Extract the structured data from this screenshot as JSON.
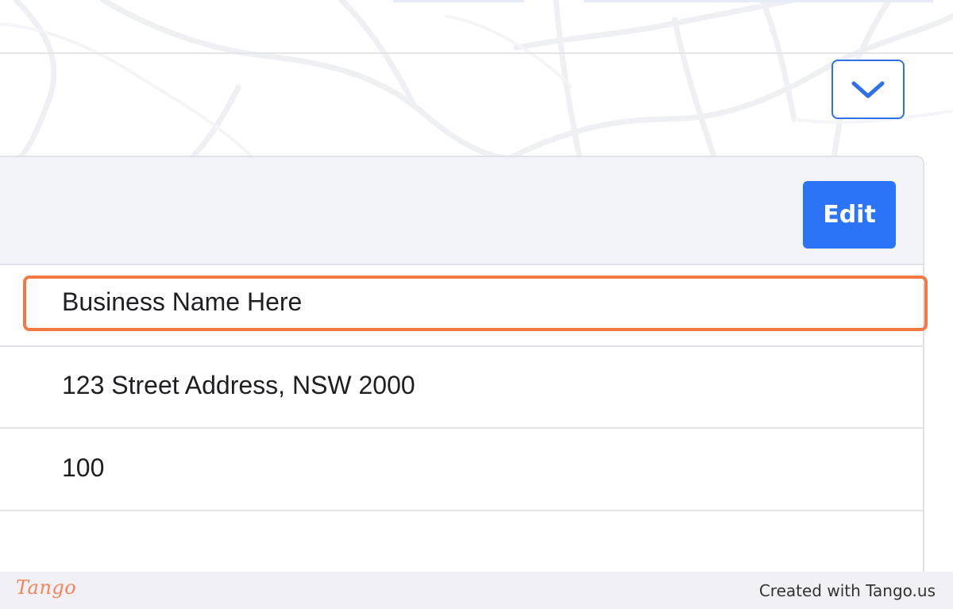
{
  "header": {
    "collapse_icon": "chevron-down-icon"
  },
  "card": {
    "edit_label": "Edit",
    "rows": [
      {
        "value": "Business Name Here"
      },
      {
        "value": "123 Street Address, NSW 2000"
      },
      {
        "value": "100"
      }
    ]
  },
  "footer": {
    "logo_text": "Tango",
    "credit": "Created with Tango.us"
  },
  "colors": {
    "accent": "#2b74f6",
    "highlight": "#f27a42",
    "footer_bg": "#f1f0f4"
  }
}
